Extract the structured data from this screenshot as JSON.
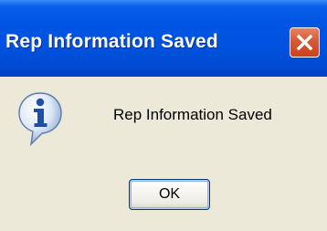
{
  "window": {
    "title": "Rep Information Saved",
    "close_icon": "close-icon"
  },
  "body": {
    "icon": "information-icon",
    "message": "Rep Information Saved"
  },
  "buttons": {
    "ok_label": "OK"
  },
  "colors": {
    "titlebar": "#0055e4",
    "dialog_background": "#ece9d8",
    "close_button": "#d65a36"
  }
}
